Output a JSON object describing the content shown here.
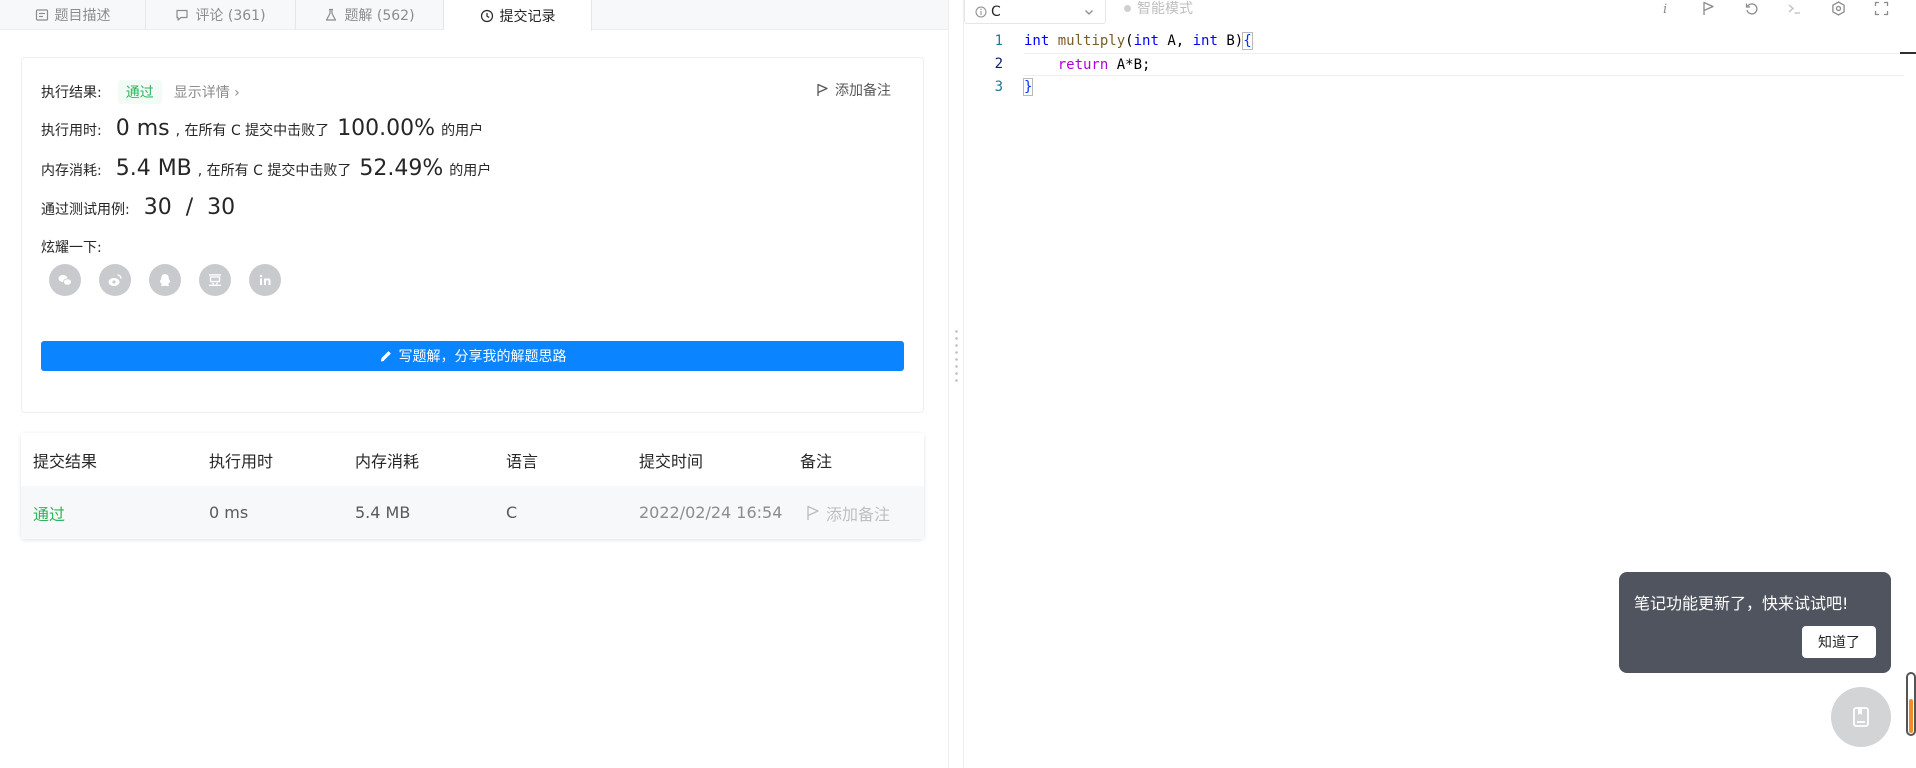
{
  "tabs": [
    {
      "label": "题目描述",
      "icon": "description-icon"
    },
    {
      "label": "评论 (361)",
      "icon": "comment-icon"
    },
    {
      "label": "题解 (562)",
      "icon": "flask-icon"
    },
    {
      "label": "提交记录",
      "icon": "clock-icon",
      "active": true
    }
  ],
  "result": {
    "status_label": "执行结果:",
    "status_value": "通过",
    "details_link": "显示详情 ›",
    "add_note": "添加备注",
    "runtime_label": "执行用时:",
    "runtime_value": "0 ms",
    "runtime_mid": ", 在所有 C 提交中击败了",
    "runtime_pct": "100.00%",
    "runtime_tail": "的用户",
    "memory_label": "内存消耗:",
    "memory_value": "5.4 MB",
    "memory_mid": ", 在所有 C 提交中击败了",
    "memory_pct": "52.49%",
    "memory_tail": "的用户",
    "cases_label": "通过测试用例:",
    "cases_value": "30  /  30",
    "share_label": "炫耀一下:",
    "share_icons": [
      "wechat-icon",
      "weibo-icon",
      "qq-icon",
      "douban-icon",
      "linkedin-icon"
    ],
    "write_button": "写题解，分享我的解题思路"
  },
  "history": {
    "columns": [
      "提交结果",
      "执行用时",
      "内存消耗",
      "语言",
      "提交时间",
      "备注"
    ],
    "rows": [
      {
        "result": "通过",
        "runtime": "0 ms",
        "memory": "5.4 MB",
        "lang": "C",
        "time": "2022/02/24 16:54",
        "note": "添加备注"
      }
    ]
  },
  "editor": {
    "language": "C",
    "smart_mode": "智能模式",
    "line_numbers": [
      "1",
      "2",
      "3"
    ],
    "toolbar_icons": [
      "info-icon",
      "flag-icon",
      "reset-icon",
      "console-icon",
      "settings-icon",
      "fullscreen-icon"
    ]
  },
  "popover": {
    "message": "笔记功能更新了，快来试试吧!",
    "button": "知道了"
  },
  "colors": {
    "accent": "#0a84ff",
    "success": "#2db55d",
    "popover_bg": "#50545e"
  }
}
